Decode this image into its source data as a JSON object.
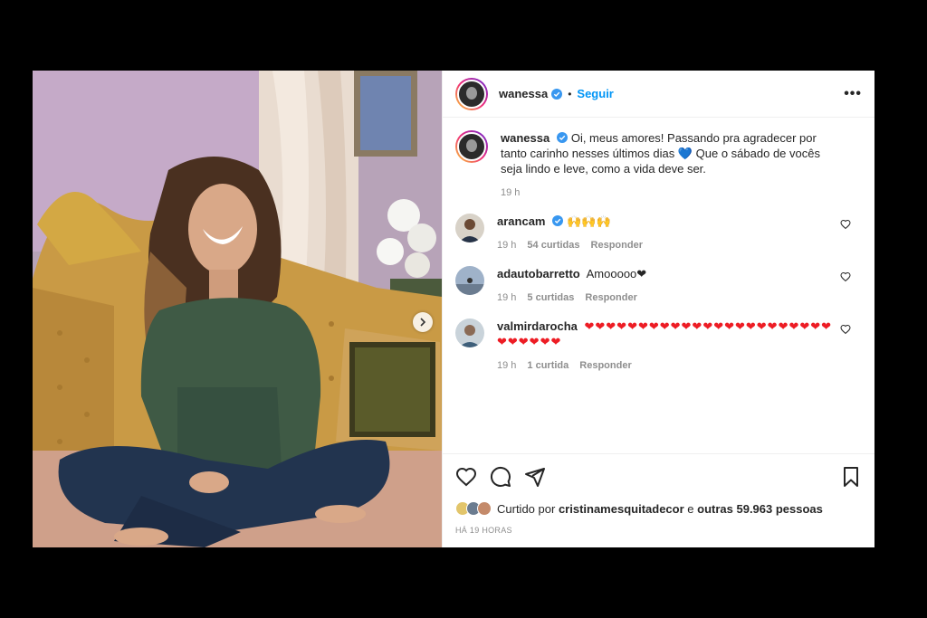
{
  "post": {
    "username": "wanessa",
    "follow_label": "Seguir",
    "dot": "•",
    "more_label": "•••",
    "caption_part1": "Oi, meus amores! Passando pra agradecer por tanto carinho nesses últimos dias",
    "caption_emoji": "💙",
    "caption_part2": "Que o sábado de vocês seja lindo e leve, como a vida deve ser.",
    "caption_time": "19 h"
  },
  "comments": [
    {
      "username": "arancam",
      "verified": true,
      "text": "🙌🙌🙌",
      "time": "19 h",
      "likes": "54 curtidas",
      "reply": "Responder"
    },
    {
      "username": "adautobarretto",
      "verified": false,
      "text": "Amooooo❤",
      "time": "19 h",
      "likes": "5 curtidas",
      "reply": "Responder"
    },
    {
      "username": "valmirdarocha",
      "verified": false,
      "text": "❤❤❤❤❤❤❤❤❤❤❤❤❤❤❤❤❤❤❤❤❤❤❤❤❤❤❤❤❤",
      "time": "19 h",
      "likes": "1 curtida",
      "reply": "Responder"
    }
  ],
  "likes": {
    "prefix": "Curtido por",
    "user": "cristinamesquitadecor",
    "middle": "e",
    "others": "outras 59.963 pessoas"
  },
  "timestamp": "HÁ 19 HORAS",
  "icons": {
    "like": "heart-icon",
    "comment": "comment-icon",
    "share": "send-icon",
    "save": "bookmark-icon"
  },
  "colors": {
    "follow": "#0095f6",
    "verified": "#3897f0",
    "heart": "#ed1c24"
  }
}
